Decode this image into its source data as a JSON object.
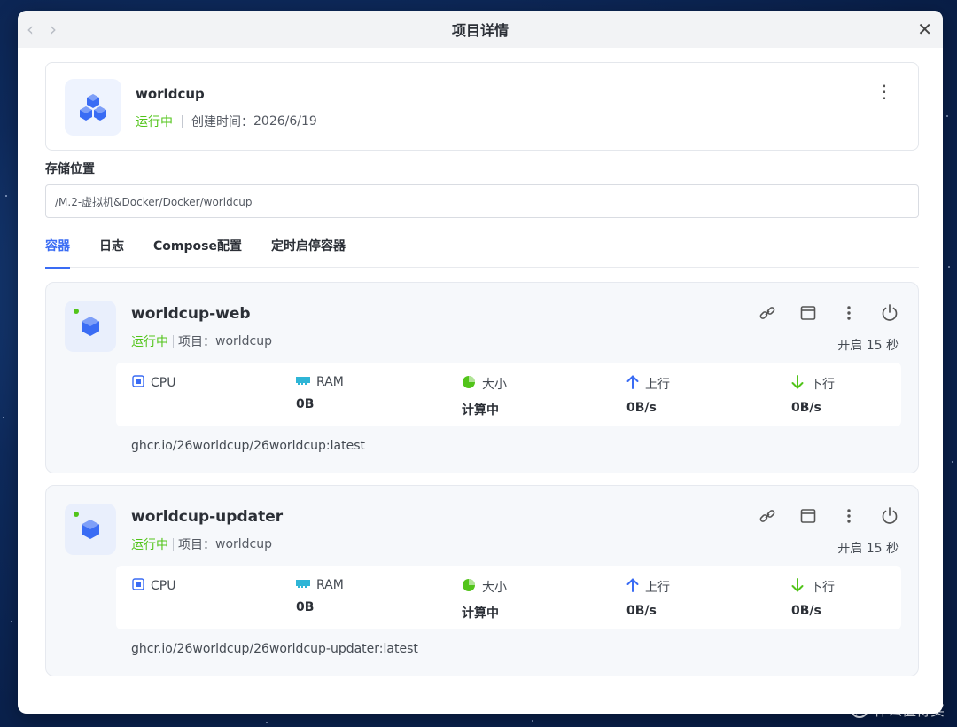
{
  "window": {
    "title": "项目详情",
    "back_icon": "‹",
    "forward_icon": "›",
    "close_icon": "✕"
  },
  "project": {
    "name": "worldcup",
    "status": "运行中",
    "created_label": "创建时间：",
    "created_date": "2026/6/19",
    "more_icon": "⋮"
  },
  "storage": {
    "label": "存储位置",
    "path": "/M.2-虚拟机&Docker/Docker/worldcup"
  },
  "tabs": [
    {
      "label": "容器",
      "active": true
    },
    {
      "label": "日志",
      "active": false
    },
    {
      "label": "Compose配置",
      "active": false
    },
    {
      "label": "定时启停容器",
      "active": false
    }
  ],
  "containers": [
    {
      "name": "worldcup-web",
      "status": "运行中",
      "project_label": "项目：",
      "project": "worldcup",
      "uptime": "开启 15 秒",
      "image": "ghcr.io/26worldcup/26worldcup:latest",
      "stats": {
        "cpu_label": "CPU",
        "cpu_value": "",
        "ram_label": "RAM",
        "ram_value": "0B",
        "size_label": "大小",
        "size_value": "计算中",
        "up_label": "上行",
        "up_value": "0B/s",
        "down_label": "下行",
        "down_value": "0B/s"
      }
    },
    {
      "name": "worldcup-updater",
      "status": "运行中",
      "project_label": "项目：",
      "project": "worldcup",
      "uptime": "开启 15 秒",
      "image": "ghcr.io/26worldcup/26worldcup-updater:latest",
      "stats": {
        "cpu_label": "CPU",
        "cpu_value": "",
        "ram_label": "RAM",
        "ram_value": "0B",
        "size_label": "大小",
        "size_value": "计算中",
        "up_label": "上行",
        "up_value": "0B/s",
        "down_label": "下行",
        "down_value": "0B/s"
      }
    }
  ],
  "colors": {
    "accent": "#3a6cf4",
    "running": "#52c41a",
    "upload": "#3a6cf4",
    "download": "#52c41a",
    "cube": "#3a6cf4"
  },
  "watermark": {
    "logo": "值",
    "text": "什么值得买"
  }
}
